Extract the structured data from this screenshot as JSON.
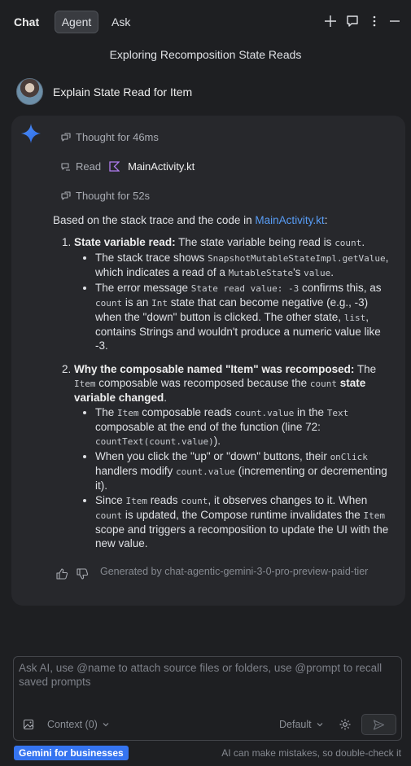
{
  "topbar": {
    "tabs": [
      "Chat",
      "Agent",
      "Ask"
    ],
    "active_tab": "Agent",
    "icons": [
      "plus-icon",
      "new-chat-icon",
      "more-vertical-icon",
      "minimize-icon"
    ]
  },
  "conversation": {
    "title": "Exploring Recomposition State Reads",
    "user_message": "Explain State Read for Item"
  },
  "steps": {
    "thought1": "Thought for 46ms",
    "read_label": "Read",
    "read_file": "MainActivity.kt",
    "thought2": "Thought for 52s"
  },
  "response": {
    "intro_prefix": "Based on the stack trace and the code in ",
    "intro_link": "MainActivity.kt",
    "intro_suffix": ":",
    "item1": {
      "heading": "State variable read:",
      "text_a": " The state variable being read is ",
      "code_a": "count",
      "text_b": ".",
      "b1": {
        "t1": "The stack trace shows ",
        "c1": "SnapshotMutableStateImpl.getValue",
        "t2": ", which indicates a read of a ",
        "c2": "MutableState",
        "t3": "'s ",
        "c3": "value",
        "t4": "."
      },
      "b2": {
        "t1": "The error message ",
        "c1": "State read value: -3",
        "t2": " confirms this, as ",
        "c2": "count",
        "t3": " is an ",
        "c3": "Int",
        "t4": " state that can become negative (e.g., -3) when the \"down\" button is clicked. The other state, ",
        "c4": "list",
        "t5": ", contains Strings and wouldn't produce a numeric value like -3."
      }
    },
    "item2": {
      "heading": "Why the composable named \"Item\" was recomposed:",
      "text_a": " The ",
      "code_a": "Item",
      "text_b": " composable was recomposed because the ",
      "code_b": "count",
      "text_c_bold": " state variable changed",
      "text_d": ".",
      "b1": {
        "t1": "The ",
        "c1": "Item",
        "t2": " composable reads ",
        "c2": "count.value",
        "t3": " in the ",
        "c3": "Text",
        "t4": " composable at the end of the function (line 72: ",
        "c4": "countText(count.value)",
        "t5": ")."
      },
      "b2": {
        "t1": "When you click the \"up\" or \"down\" buttons, their ",
        "c1": "onClick",
        "t2": " handlers modify ",
        "c2": "count.value",
        "t3": " (incrementing or decrementing it)."
      },
      "b3": {
        "t1": "Since ",
        "c1": "Item",
        "t2": " reads ",
        "c2": "count",
        "t3": ", it observes changes to it. When ",
        "c3": "count",
        "t4": " is updated, the Compose runtime invalidates the ",
        "c4": "Item",
        "t5": " scope and triggers a recomposition to update the UI with the new value."
      }
    },
    "generated_by": "Generated by chat-agentic-gemini-3-0-pro-preview-paid-tier"
  },
  "input": {
    "placeholder": "Ask AI, use @name to attach source files or folders, use @prompt to recall saved prompts",
    "context_label": "Context (0)",
    "model_label": "Default"
  },
  "footer": {
    "badge": "Gemini for businesses",
    "disclaimer": "AI can make mistakes, so double-check it"
  },
  "colors": {
    "background": "#1e1f22",
    "card": "#27282c",
    "link": "#589df6",
    "badge": "#3574f0"
  }
}
